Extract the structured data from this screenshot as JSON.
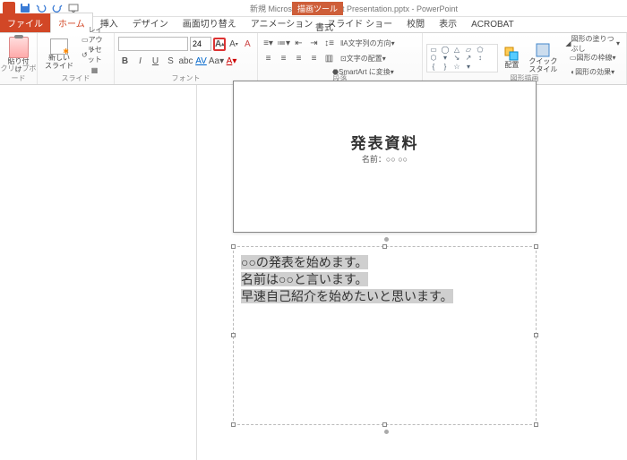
{
  "qat": {
    "title": "新規 Microsoft PowerPoint Presentation.pptx - PowerPoint",
    "tooltab": "描画ツール",
    "format": "書式"
  },
  "tabs": {
    "file": "ファイル",
    "home": "ホーム",
    "insert": "挿入",
    "design": "デザイン",
    "transitions": "画面切り替え",
    "animations": "アニメーション",
    "slideshow": "スライド ショー",
    "review": "校閲",
    "view": "表示",
    "acrobat": "ACROBAT"
  },
  "ribbon": {
    "clipboard": {
      "label": "クリップボード",
      "paste": "貼り付け"
    },
    "slides": {
      "label": "スライド",
      "new": "新しい\nスライド",
      "layout": "レイアウト",
      "reset": "リセット"
    },
    "font": {
      "label": "フォント",
      "size": "24"
    },
    "para": {
      "label": "段落",
      "textdir": "文字列の方向",
      "align": "文字の配置",
      "smartart": "SmartArt に変換"
    },
    "drawing": {
      "label": "図形描画",
      "arrange": "配置",
      "quickstyle": "クイック\nスタイル",
      "fill": "図形の塗りつぶし",
      "outline": "図形の枠線",
      "effects": "図形の効果"
    }
  },
  "slide": {
    "title": "発表資料",
    "subtitle": "名前：○○ ○○"
  },
  "notes": {
    "l1": "○○の発表を始めます。",
    "l2": "名前は○○と言います。",
    "l3": "早速自己紹介を始めたいと思います。"
  }
}
